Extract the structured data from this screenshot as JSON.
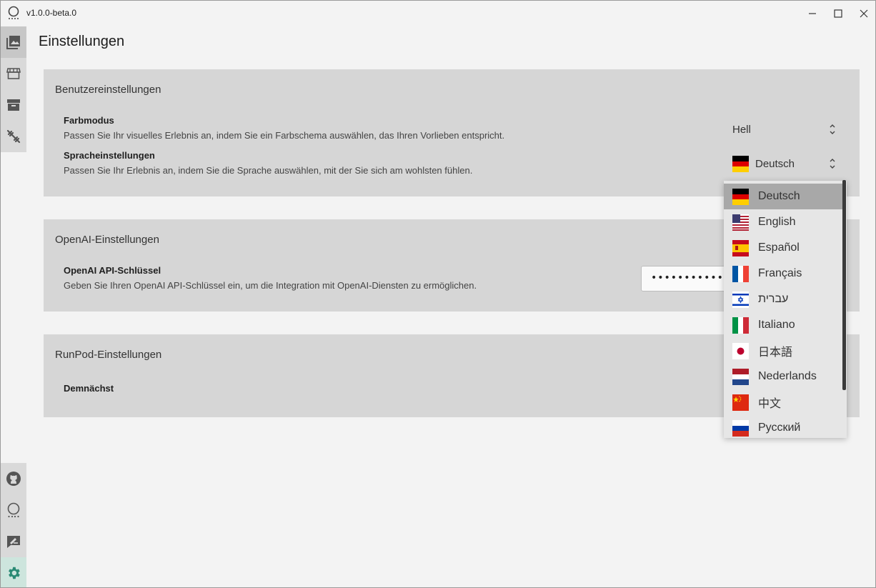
{
  "app": {
    "title": "v1.0.0-beta.0"
  },
  "page": {
    "title": "Einstellungen"
  },
  "sections": {
    "user": {
      "title": "Benutzereinstellungen",
      "color_mode": {
        "label": "Farbmodus",
        "description": "Passen Sie Ihr visuelles Erlebnis an, indem Sie ein Farbschema auswählen, das Ihren Vorlieben entspricht.",
        "value": "Hell"
      },
      "language": {
        "label": "Spracheinstellungen",
        "description": "Passen Sie Ihr Erlebnis an, indem Sie die Sprache auswählen, mit der Sie sich am wohlsten fühlen.",
        "value": "Deutsch"
      }
    },
    "openai": {
      "title": "OpenAI-Einstellungen",
      "api_key": {
        "label": "OpenAI API-Schlüssel",
        "description": "Geben Sie Ihren OpenAI API-Schlüssel ein, um die Integration mit OpenAI-Diensten zu ermöglichen.",
        "value": "••••••••••••••"
      }
    },
    "runpod": {
      "title": "RunPod-Einstellungen",
      "notice": "Demnächst"
    }
  },
  "language_options": [
    {
      "label": "Deutsch",
      "flag": "de-flag-icon",
      "selected": true
    },
    {
      "label": "English",
      "flag": "us-flag-icon"
    },
    {
      "label": "Español",
      "flag": "es-flag-icon"
    },
    {
      "label": "Français",
      "flag": "fr-flag-icon"
    },
    {
      "label": "עברית",
      "flag": "il-flag-icon"
    },
    {
      "label": "Italiano",
      "flag": "it-flag-icon"
    },
    {
      "label": "日本語",
      "flag": "jp-flag-icon"
    },
    {
      "label": "Nederlands",
      "flag": "nl-flag-icon"
    },
    {
      "label": "中文",
      "flag": "cn-flag-icon"
    },
    {
      "label": "Русский",
      "flag": "ru-flag-icon"
    }
  ],
  "sidebar": {
    "top_items": [
      "images-icon",
      "store-icon",
      "archive-icon",
      "training-icon"
    ],
    "bottom_items": [
      "github-icon",
      "app-logo-icon",
      "feedback-icon",
      "settings-icon"
    ]
  },
  "colors": {
    "card_bg": "#d6d6d6",
    "sidebar_bg": "#d9d9d9",
    "settings_active_bg": "#cde5dd",
    "settings_icon": "#2a8a74",
    "dropdown_selected_bg": "#a8a8a8"
  }
}
